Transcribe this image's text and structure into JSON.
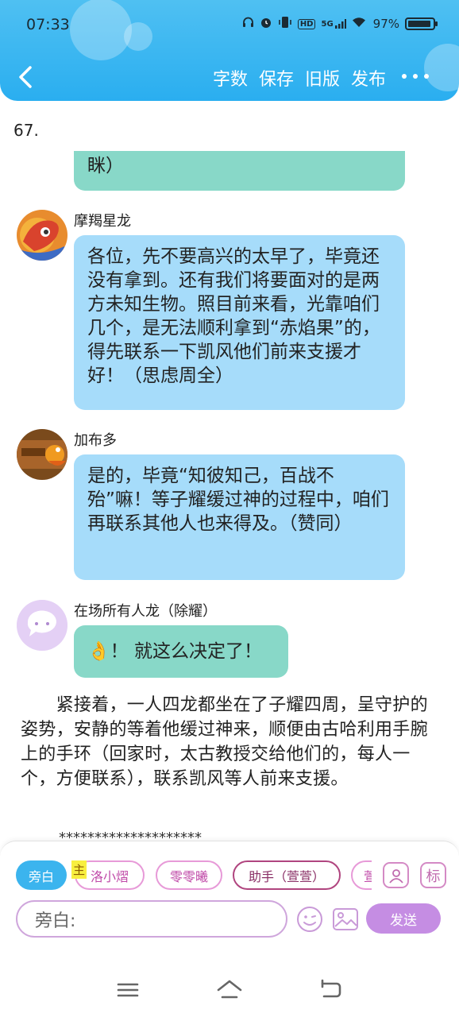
{
  "status_bar": {
    "time": "07:33",
    "battery_percent": "97%",
    "network": "5G",
    "hd": "HD"
  },
  "nav": {
    "actions": [
      "字数",
      "保存",
      "旧版",
      "发布"
    ]
  },
  "chapter_number": "67.",
  "messages": [
    {
      "speaker": "",
      "text": "眯）",
      "style": "teal"
    },
    {
      "speaker": "摩羯星龙",
      "text": "各位，先不要高兴的太早了，毕竟还没有拿到。还有我们将要面对的是两方未知生物。照目前来看，光靠咱们几个，是无法顺利拿到“赤焰果”的，得先联系一下凯风他们前来支援才好！（思虑周全）",
      "style": "blue"
    },
    {
      "speaker": "加布多",
      "text": "是的，毕竟“知彼知己，百战不殆”嘛！等子耀缓过神的过程中，咱们再联系其他人也来得及。（赞同）",
      "style": "blue"
    },
    {
      "speaker": "在场所有人龙（除耀）",
      "text": "👌！ 就这么决定了！",
      "style": "teal"
    }
  ],
  "narration": "　　紧接着，一人四龙都坐在了子耀四周，呈守护的姿势，安静的等着他缓过神来，顺便由古哈利用手腕上的手环（回家时，太古教授交给他们的，每人一个，方便联系），联系凯风等人前来支援。",
  "separator": "********************",
  "role_chips": [
    {
      "label": "旁白",
      "style": "active"
    },
    {
      "label": "洛小熠",
      "style": "pink",
      "tag": "主"
    },
    {
      "label": "零零曦",
      "style": "pink"
    },
    {
      "label": "助手（萱萱）",
      "style": "dark"
    },
    {
      "label": "萱",
      "style": "pink"
    }
  ],
  "side_buttons": {
    "person": "person-icon",
    "tag_label": "标"
  },
  "input": {
    "placeholder": "旁白:"
  },
  "send_label": "发送"
}
